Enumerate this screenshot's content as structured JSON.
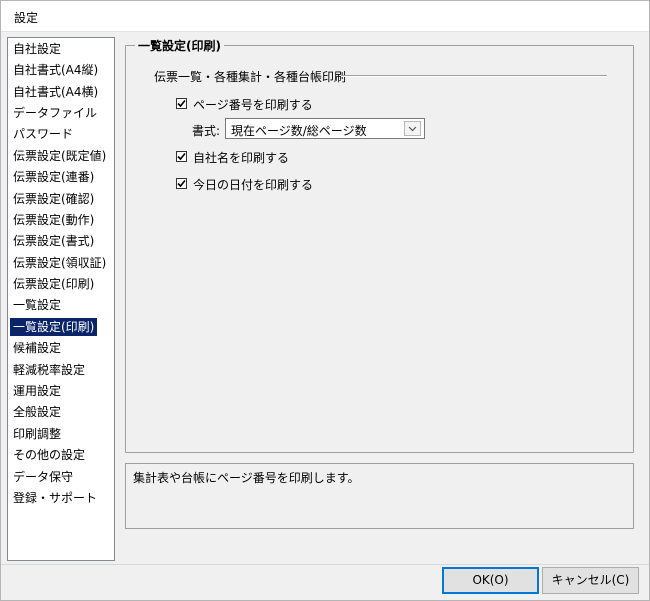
{
  "window": {
    "title": "設定"
  },
  "sidebar": {
    "items": [
      {
        "label": "自社設定"
      },
      {
        "label": "自社書式(A4縦)"
      },
      {
        "label": "自社書式(A4横)"
      },
      {
        "label": "データファイル"
      },
      {
        "label": "パスワード"
      },
      {
        "label": "伝票設定(既定値)"
      },
      {
        "label": "伝票設定(連番)"
      },
      {
        "label": "伝票設定(確認)"
      },
      {
        "label": "伝票設定(動作)"
      },
      {
        "label": "伝票設定(書式)"
      },
      {
        "label": "伝票設定(領収証)"
      },
      {
        "label": "伝票設定(印刷)"
      },
      {
        "label": "一覧設定"
      },
      {
        "label": "一覧設定(印刷)"
      },
      {
        "label": "候補設定"
      },
      {
        "label": "軽減税率設定"
      },
      {
        "label": "運用設定"
      },
      {
        "label": "全般設定"
      },
      {
        "label": "印刷調整"
      },
      {
        "label": "その他の設定"
      },
      {
        "label": "データ保守"
      },
      {
        "label": "登録・サポート"
      }
    ],
    "selected_index": 13
  },
  "panel": {
    "group_title": "一覧設定(印刷)",
    "section_label": "伝票一覧・各種集計・各種台帳印刷",
    "print_page_number": {
      "label": "ページ番号を印刷する",
      "checked": true
    },
    "format": {
      "label": "書式:",
      "value": "現在ページ数/総ページ数"
    },
    "print_company_name": {
      "label": "自社名を印刷する",
      "checked": true
    },
    "print_today_date": {
      "label": "今日の日付を印刷する",
      "checked": true
    }
  },
  "description": {
    "text": "集計表や台帳にページ番号を印刷します。"
  },
  "buttons": {
    "ok_label": "OK(O)",
    "cancel_label": "キャンセル(C)"
  },
  "icons": {
    "checkmark": "check-icon",
    "dropdown": "chevron-down-icon"
  },
  "colors": {
    "selection": "#0a246a",
    "default_button_border": "#0078d7"
  }
}
